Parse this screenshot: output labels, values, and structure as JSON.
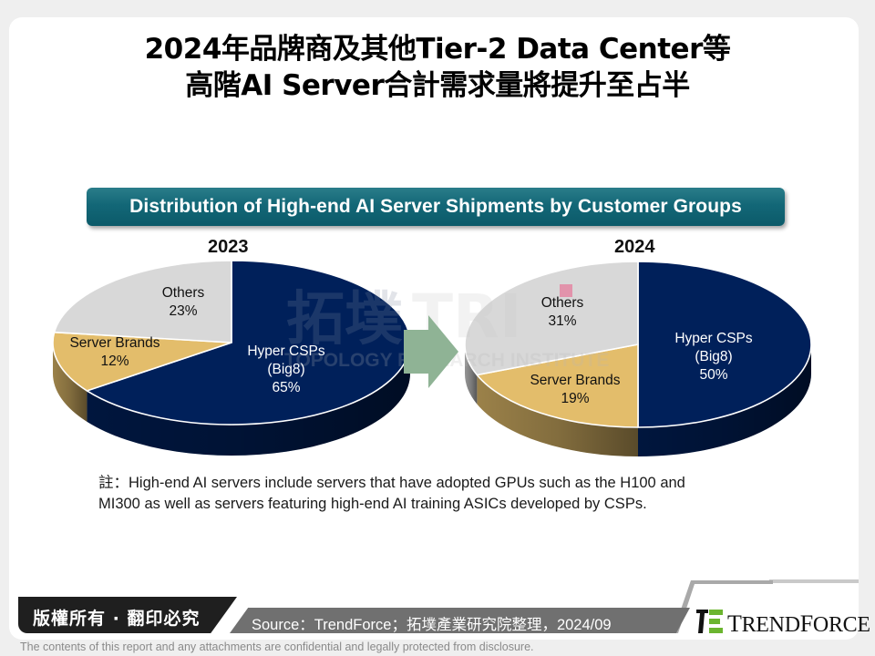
{
  "header": {
    "title_line1": "2024年品牌商及其他Tier-2 Data Center等",
    "title_line2": "高階AI Server合計需求量將提升至占半"
  },
  "banner": {
    "title": "Distribution of High-end AI Server Shipments by Customer Groups"
  },
  "colors": {
    "hyper": "#00205a",
    "brands": "#e3bd6b",
    "others": "#d8d8d8",
    "arrow": "#8fb395",
    "banner": "#136777",
    "marker": "#e293ab"
  },
  "chart_data": [
    {
      "type": "pie",
      "title": "2023",
      "unit": "%",
      "slices": [
        {
          "label": "Hyper CSPs (Big8)",
          "label_lines": [
            "Hyper CSPs",
            "(Big8)",
            "65%"
          ],
          "value": 65,
          "color_key": "hyper"
        },
        {
          "label": "Server Brands",
          "label_lines": [
            "Server Brands",
            "12%"
          ],
          "value": 12,
          "color_key": "brands"
        },
        {
          "label": "Others",
          "label_lines": [
            "Others",
            "23%"
          ],
          "value": 23,
          "color_key": "others"
        }
      ]
    },
    {
      "type": "pie",
      "title": "2024",
      "unit": "%",
      "slices": [
        {
          "label": "Hyper CSPs (Big8)",
          "label_lines": [
            "Hyper CSPs",
            "(Big8)",
            "50%"
          ],
          "value": 50,
          "color_key": "hyper"
        },
        {
          "label": "Server Brands",
          "label_lines": [
            "Server Brands",
            "19%"
          ],
          "value": 19,
          "color_key": "brands"
        },
        {
          "label": "Others",
          "label_lines": [
            "Others",
            "31%"
          ],
          "value": 31,
          "color_key": "others"
        }
      ]
    }
  ],
  "transition_arrow": {
    "icon": "right-arrow-icon",
    "from": "2023",
    "to": "2024"
  },
  "watermark": {
    "cn": "拓墣",
    "en": "TOPOLOGY RESEARCH INSTITUTE",
    "initials": "TRI"
  },
  "note": {
    "prefix": "註：",
    "line1": "High-end AI servers include servers that have adopted GPUs such as the H100 and",
    "line2": "MI300 as well as servers featuring high-end AI training ASICs developed by CSPs."
  },
  "footer": {
    "copyright": "版權所有 · 翻印必究",
    "source": "Source：TrendForce；拓墣產業研究院整理，2024/09",
    "logo_text_first": "T",
    "logo_text_rest": "REND",
    "logo_text_f": "F",
    "logo_text_rest2": "ORCE",
    "disclaimer": "The contents of this report and any attachments are confidential and legally protected from disclosure."
  }
}
